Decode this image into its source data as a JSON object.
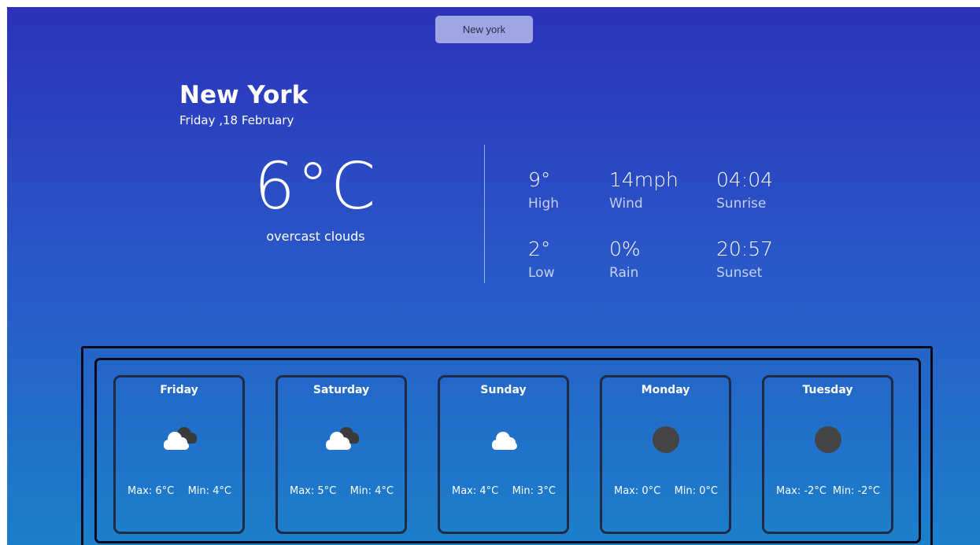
{
  "search": {
    "value": "New york"
  },
  "location": {
    "city": "New York",
    "date": "Friday ,18 February"
  },
  "current": {
    "temp": "6°C",
    "description": "overcast clouds"
  },
  "stats": [
    {
      "value": "9°",
      "label": "High"
    },
    {
      "value": "14mph",
      "label": "Wind"
    },
    {
      "value": "04:04",
      "label": "Sunrise"
    },
    {
      "value": "2°",
      "label": "Low"
    },
    {
      "value": "0%",
      "label": "Rain"
    },
    {
      "value": "20:57",
      "label": "Sunset"
    }
  ],
  "forecast": [
    {
      "day": "Friday",
      "icon": "broken-clouds-icon",
      "max": "Max: 6°C",
      "min": "Min: 4°C"
    },
    {
      "day": "Saturday",
      "icon": "broken-clouds-icon",
      "max": "Max: 5°C",
      "min": "Min: 4°C"
    },
    {
      "day": "Sunday",
      "icon": "cloud-icon",
      "max": "Max: 4°C",
      "min": "Min: 3°C"
    },
    {
      "day": "Monday",
      "icon": "dark-circle-icon",
      "max": "Max: 0°C",
      "min": "Min: 0°C"
    },
    {
      "day": "Tuesday",
      "icon": "dark-circle-icon",
      "max": "Max: -2°C",
      "min": "Min: -2°C"
    }
  ],
  "colors": {
    "gradient_top": "#2b32b9",
    "gradient_bottom": "#1b80cb",
    "search_bg": "#9ea6e4",
    "border": "#0a0a1a",
    "cloud_dark": "#3a3a3a",
    "icon_circle": "#444444"
  }
}
